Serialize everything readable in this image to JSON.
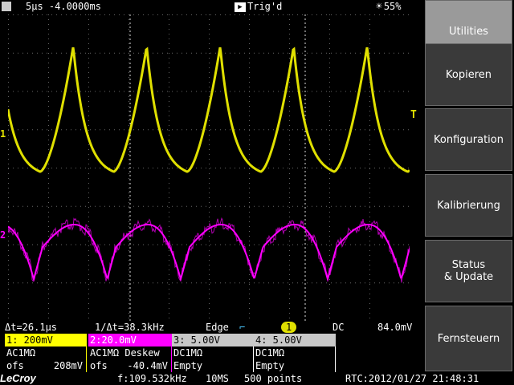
{
  "topbar": {
    "timebase": "5µs -4.0000ms",
    "trigger_status": "Trig'd",
    "brightness": "55%"
  },
  "markers": {
    "ch1": "1",
    "ch2": "2",
    "trigger_level": "T"
  },
  "measure": {
    "delta_t": "Δt=26.1µs",
    "inv_delta_t": "1/Δt=38.3kHz",
    "trigger_type": "Edge",
    "trigger_source": "1",
    "coupling": "DC",
    "level": "84.0mV"
  },
  "channels": [
    {
      "header": "1: 200mV",
      "row1": "AC1MΩ",
      "row2_left": "ofs",
      "row2_right": "208mV",
      "color": "#ffff00"
    },
    {
      "header": "2:20.0mV",
      "row1": "AC1MΩ  Deskew",
      "row2_left": "ofs",
      "row2_right": "-40.4mV",
      "color": "#ff00ff"
    },
    {
      "header": "3: 5.00V",
      "row1": "DC1MΩ",
      "row2_left": "Empty",
      "row2_right": "",
      "color": "#c8c8c8"
    },
    {
      "header": "4: 5.00V",
      "row1": "DC1MΩ",
      "row2_left": "Empty",
      "row2_right": "",
      "color": "#c8c8c8"
    }
  ],
  "status": {
    "logo": "LeCroy",
    "frequency": "f:109.532kHz",
    "sample_rate": "10MS",
    "points": "500 points",
    "rtc": "RTC:2012/01/27 21:48:31"
  },
  "softkeys": [
    "Utilities",
    "Kopieren",
    "Konfiguration",
    "Kalibrierung",
    "Status\n& Update",
    "Fernsteuern"
  ],
  "colors": {
    "ch1": "#e0e000",
    "ch2": "#ff00ff",
    "grid": "#555555"
  }
}
